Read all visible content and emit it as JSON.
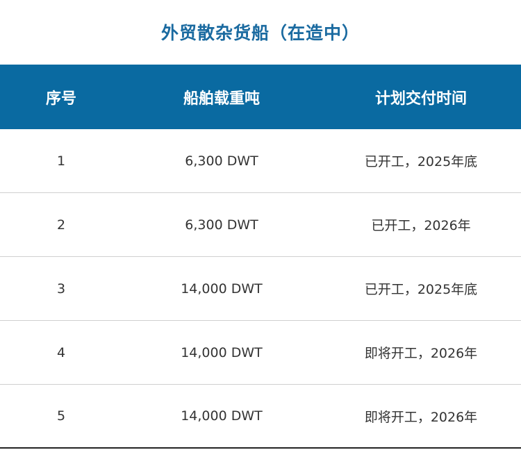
{
  "title": "外贸散杂货船（在造中）",
  "table": {
    "headers": [
      "序号",
      "船舶载重吨",
      "计划交付时间"
    ],
    "rows": [
      [
        "1",
        "6,300 DWT",
        "已开工，2025年底"
      ],
      [
        "2",
        "6,300 DWT",
        "已开工，2026年"
      ],
      [
        "3",
        "14,000 DWT",
        "已开工，2025年底"
      ],
      [
        "4",
        "14,000 DWT",
        "即将开工，2026年"
      ],
      [
        "5",
        "14,000 DWT",
        "即将开工，2026年"
      ]
    ]
  },
  "colors": {
    "title": "#1a6aa0",
    "header_bg": "#0a6aa1",
    "header_text": "#ffffff",
    "body_text": "#333333"
  }
}
